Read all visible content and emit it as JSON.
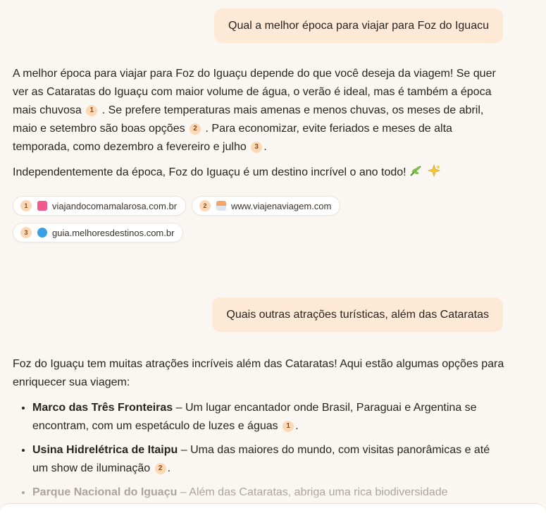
{
  "conversation": {
    "q1": "Qual a melhor época para viajar para Foz do Iguacu",
    "a1": {
      "p1_s1": "A melhor época para viajar para Foz do Iguaçu depende do que você deseja da viagem! Se quer ver as Cataratas do Iguaçu com maior volume de água, o verão é ideal, mas é também a época mais chuvosa",
      "p1_s2": ". Se prefere temperaturas mais amenas e menos chuvas, os meses de abril, maio e setembro são boas opções",
      "p1_s3": ". Para economizar, evite feriados e meses de alta temporada, como dezembro a fevereiro e julho",
      "p1_end": ".",
      "p2": "Independentemente da época, Foz do Iguaçu é um destino incrível o ano todo!",
      "cite1": "1",
      "cite2": "2",
      "cite3": "3"
    },
    "sources": [
      {
        "num": "1",
        "domain": "viajandocomamalarosa.com.br",
        "favicon": "pink-square-icon"
      },
      {
        "num": "2",
        "domain": "www.viajenaviagem.com",
        "favicon": "orange-logo-icon"
      },
      {
        "num": "3",
        "domain": "guia.melhoresdestinos.com.br",
        "favicon": "blue-round-icon"
      }
    ],
    "q2": "Quais outras atrações turísticas, além das Cataratas",
    "a2": {
      "intro": "Foz do Iguaçu tem muitas atrações incríveis além das Cataratas! Aqui estão algumas opções para enriquecer sua viagem:",
      "items": [
        {
          "title": "Marco das Três Fronteiras",
          "text": " – Um lugar encantador onde Brasil, Paraguai e Argentina se encontram, com um espetáculo de luzes e águas",
          "cite": "1",
          "end": "."
        },
        {
          "title": "Usina Hidrelétrica de Itaipu",
          "text": " – Uma das maiores do mundo, com visitas panorâmicas e até um show de iluminação",
          "cite": "2",
          "end": "."
        },
        {
          "title": "Parque Nacional do Iguaçu",
          "text": " – Além das Cataratas, abriga uma rica biodiversidade"
        }
      ]
    }
  },
  "colors": {
    "background": "#faf6f1",
    "user_bubble": "#fde9d5",
    "citation_badge": "#fcd9b6"
  }
}
